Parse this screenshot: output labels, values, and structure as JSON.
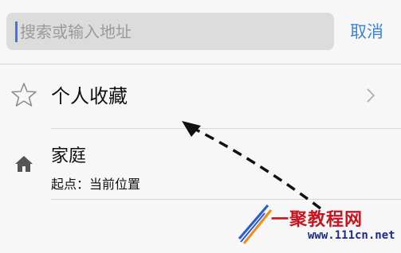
{
  "search": {
    "placeholder": "搜索或输入地址",
    "value": "",
    "cancel_label": "取消"
  },
  "list": {
    "favorites": {
      "label": "个人收藏",
      "icon": "star-icon"
    },
    "home": {
      "title": "家庭",
      "subtitle": "起点：当前位置",
      "icon": "home-icon"
    }
  },
  "watermark": {
    "text": "一聚教程网",
    "url": "www.111cn.net"
  },
  "colors": {
    "accent": "#3a84e0",
    "watermark_red": "#c8141e",
    "watermark_blue": "#1a2a8a"
  }
}
